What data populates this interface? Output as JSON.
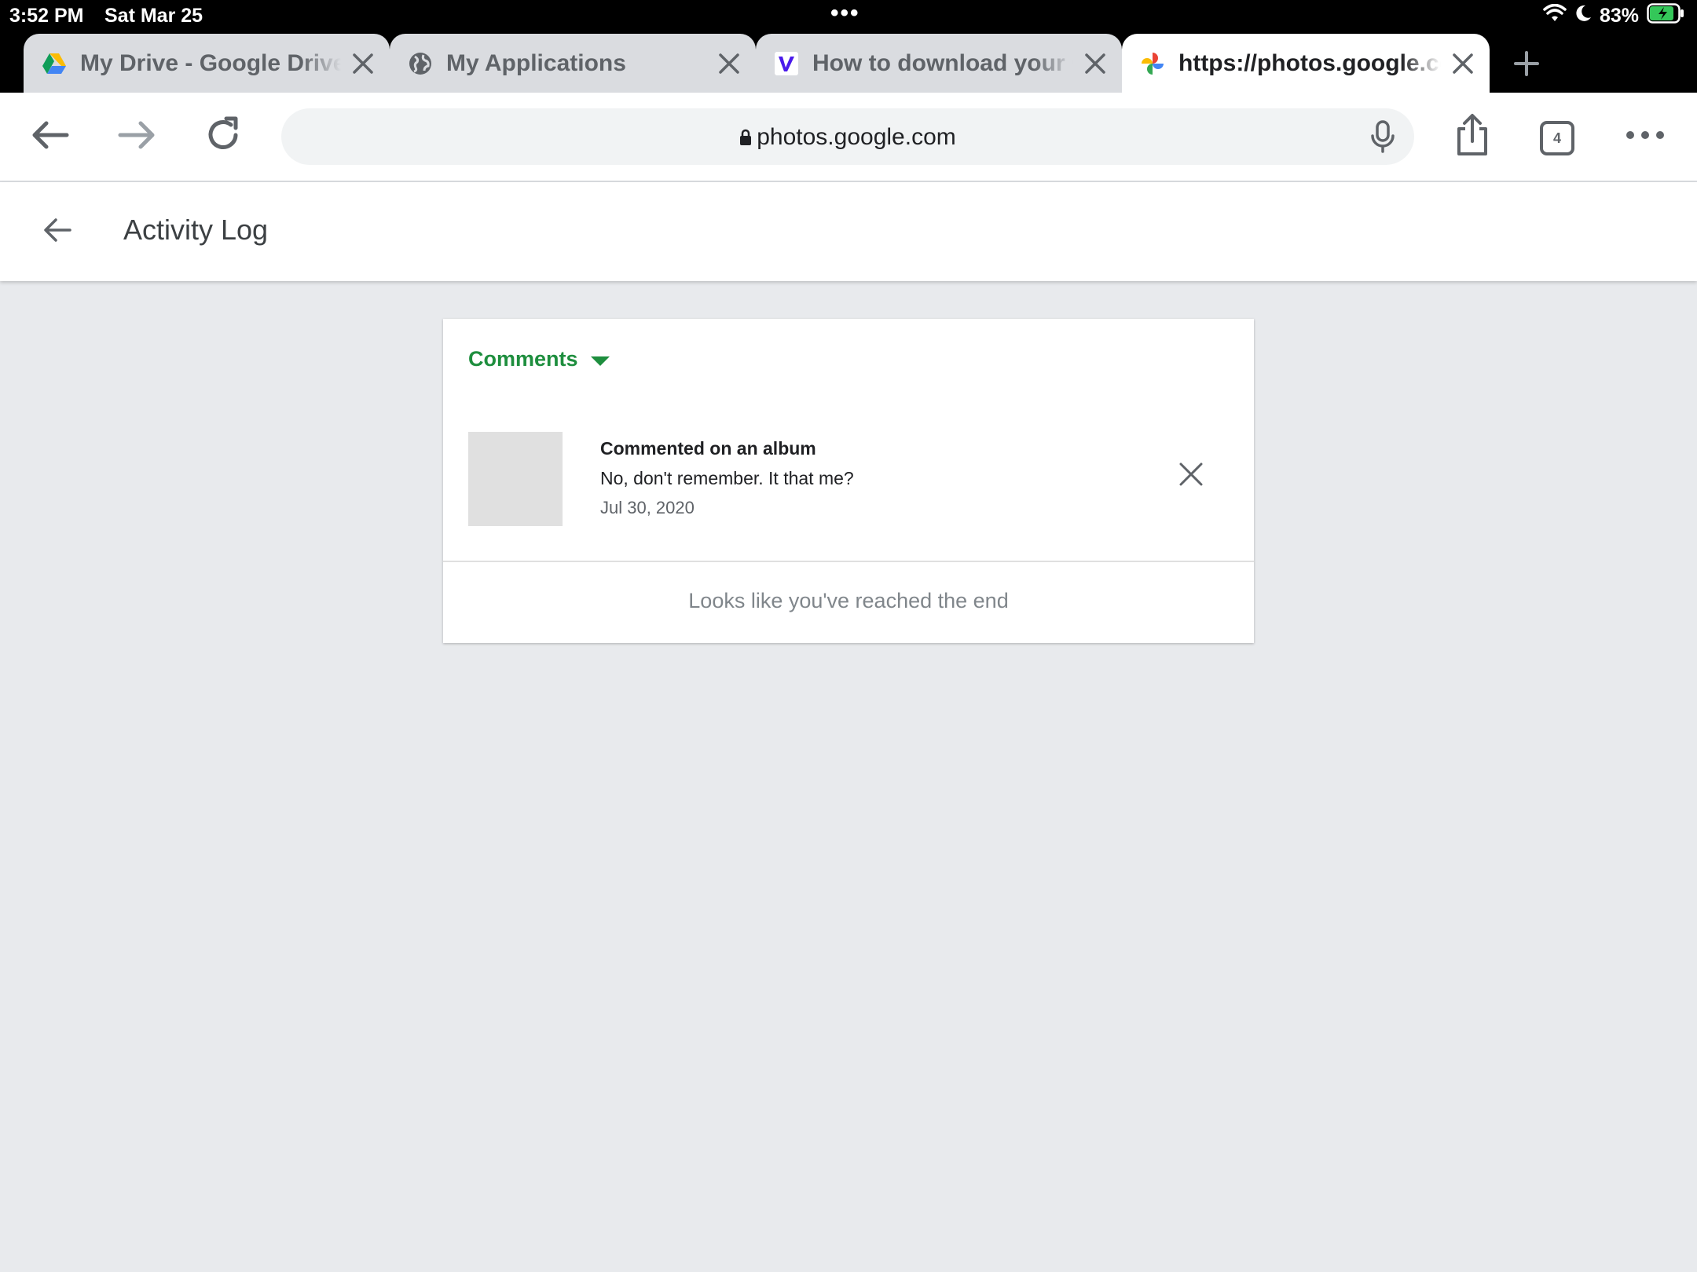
{
  "status_bar": {
    "time": "3:52 PM",
    "date": "Sat Mar 25",
    "multitask_dots": "•••",
    "battery": "83%"
  },
  "browser": {
    "tabs": [
      {
        "title": "My Drive - Google Drive",
        "favicon": "google-drive-icon",
        "active": false
      },
      {
        "title": "My Applications",
        "favicon": "globe-icon",
        "active": false
      },
      {
        "title": "How to download your G",
        "favicon": "v-logo-icon",
        "active": false
      },
      {
        "title": "https://photos.google.com",
        "favicon": "google-photos-icon",
        "active": true
      }
    ],
    "address": "photos.google.com",
    "tab_count": "4"
  },
  "app": {
    "page_title": "Activity Log",
    "filter_label": "Comments",
    "activity": {
      "title": "Commented on an album",
      "text": "No, don't remember. It that me?",
      "date": "Jul 30, 2020"
    },
    "end_message": "Looks like you've reached the end"
  },
  "colors": {
    "accent_green": "#1e8e3e",
    "page_background": "#e8eaed",
    "thumbnail_placeholder": "#e0e0e0"
  }
}
